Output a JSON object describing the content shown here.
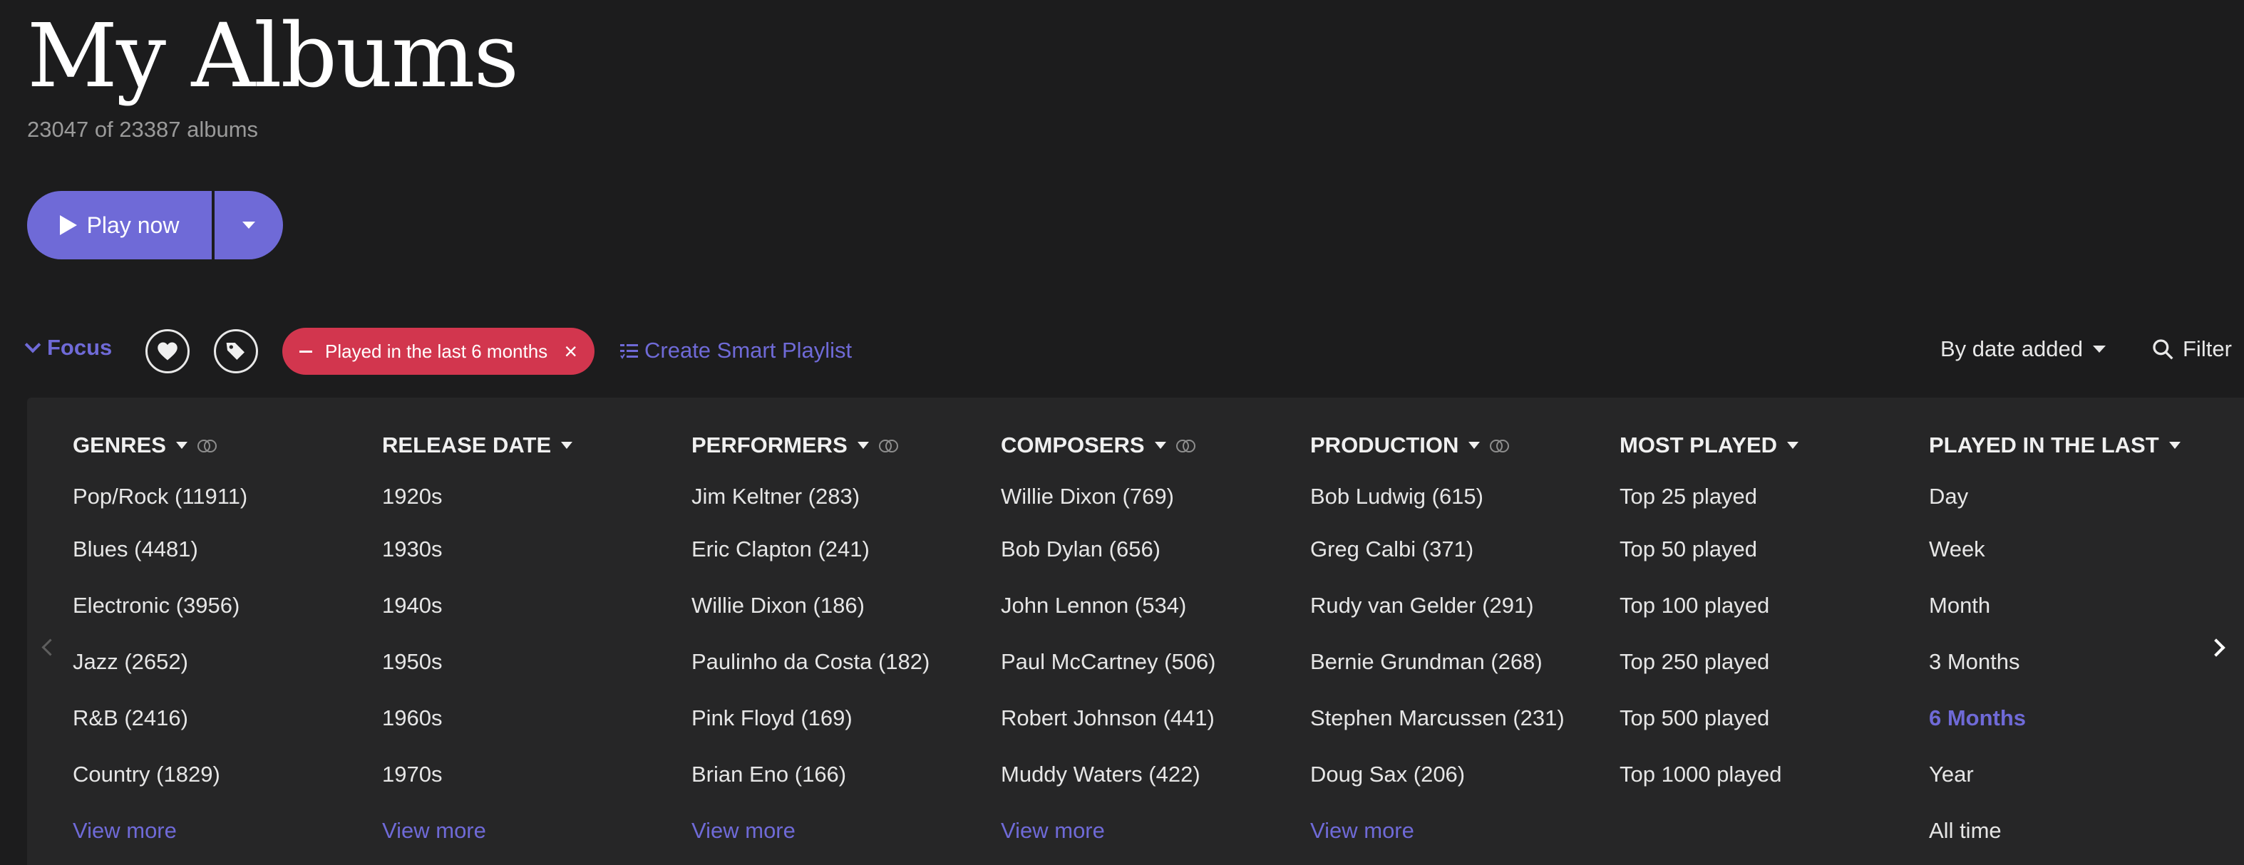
{
  "header": {
    "title": "My Albums",
    "subtitle": "23047 of 23387 albums"
  },
  "play": {
    "label": "Play now"
  },
  "focus_bar": {
    "focus_label": "Focus",
    "active_filter": "Played in the last 6 months",
    "smart_playlist_label": "Create Smart Playlist",
    "sort_label": "By date added",
    "filter_label": "Filter"
  },
  "columns": [
    {
      "title": "GENRES",
      "has_rings": true,
      "items": [
        "Pop/Rock (11911)",
        "Blues (4481)",
        "Electronic (3956)",
        "Jazz (2652)",
        "R&B (2416)",
        "Country (1829)"
      ],
      "view_more": "View more"
    },
    {
      "title": "RELEASE DATE",
      "has_rings": false,
      "items": [
        "1920s",
        "1930s",
        "1940s",
        "1950s",
        "1960s",
        "1970s"
      ],
      "view_more": "View more"
    },
    {
      "title": "PERFORMERS",
      "has_rings": true,
      "items": [
        "Jim Keltner (283)",
        "Eric Clapton (241)",
        "Willie Dixon (186)",
        "Paulinho da Costa (182)",
        "Pink Floyd (169)",
        "Brian Eno (166)"
      ],
      "view_more": "View more"
    },
    {
      "title": "COMPOSERS",
      "has_rings": true,
      "items": [
        "Willie Dixon (769)",
        "Bob Dylan (656)",
        "John Lennon (534)",
        "Paul McCartney (506)",
        "Robert Johnson (441)",
        "Muddy Waters (422)"
      ],
      "view_more": "View more"
    },
    {
      "title": "PRODUCTION",
      "has_rings": true,
      "items": [
        "Bob Ludwig (615)",
        "Greg Calbi (371)",
        "Rudy van Gelder (291)",
        "Bernie Grundman (268)",
        "Stephen Marcussen (231)",
        "Doug Sax (206)"
      ],
      "view_more": "View more"
    },
    {
      "title": "MOST PLAYED",
      "has_rings": false,
      "items": [
        "Top 25 played",
        "Top 50 played",
        "Top 100 played",
        "Top 250 played",
        "Top 500 played",
        "Top 1000 played"
      ]
    },
    {
      "title": "PLAYED IN THE LAST",
      "has_rings": false,
      "items": [
        "Day",
        "Week",
        "Month",
        "3 Months",
        "6 Months",
        "Year",
        "All time"
      ],
      "selected": "6 Months"
    }
  ],
  "colors": {
    "accent": "#6f6ad7",
    "filter_pill": "#d2364e",
    "background": "#1c1c1d",
    "panel": "#262627"
  },
  "icons": {
    "play": "play-icon",
    "heart": "heart-icon",
    "tag": "tag-icon",
    "smart_playlist": "smart-playlist-icon",
    "search": "search-icon"
  }
}
